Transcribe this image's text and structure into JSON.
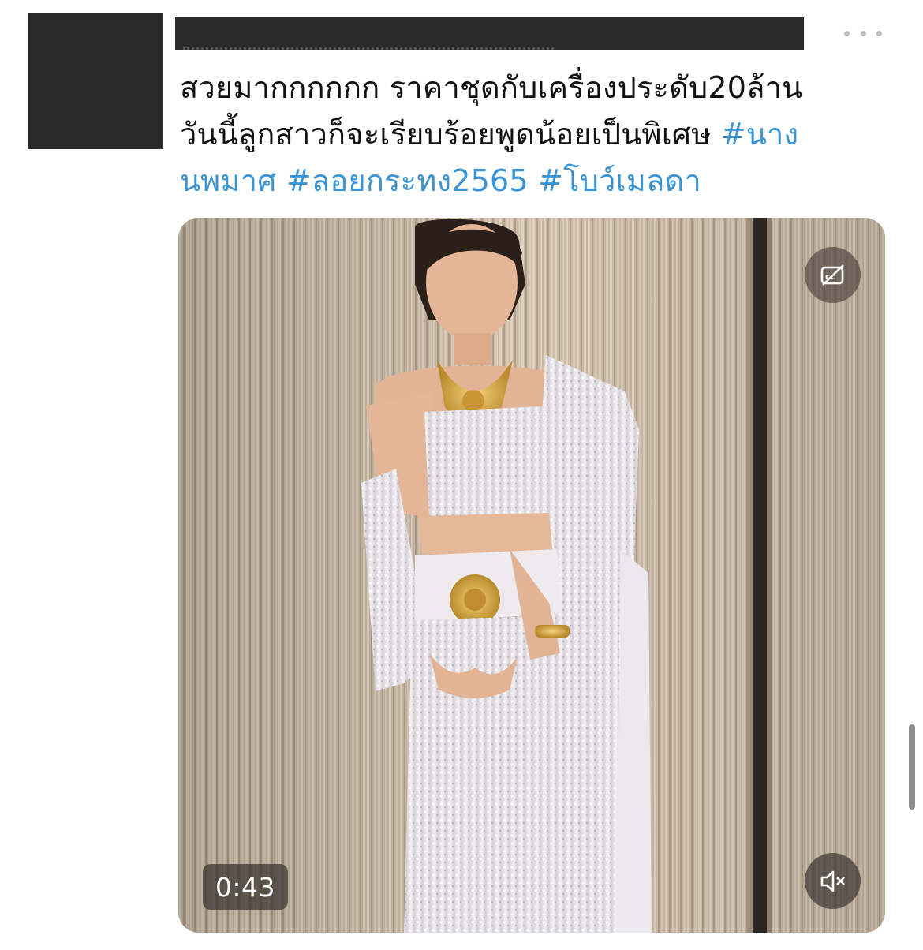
{
  "tweet": {
    "text_line1": "สวยมากกกกกก ราคาชุดกับเครื่องประดับ20ล้าน",
    "text_line2": "วันนี้ลูกสาวก็จะเรียบร้อยพูดน้อยเป็นพิเศษ",
    "hashtags": [
      "#นาง",
      "นพมาศ",
      "#ลอยกระทง2565",
      "#โบว์เมลดา"
    ],
    "more_icon": "more-horizontal-icon"
  },
  "video": {
    "duration": "0:43",
    "captions_icon": "captions-off-icon",
    "mute_icon": "volume-muted-icon"
  },
  "colors": {
    "link": "#3a93d3",
    "text": "#111111",
    "redaction": "#2a2a2a"
  }
}
